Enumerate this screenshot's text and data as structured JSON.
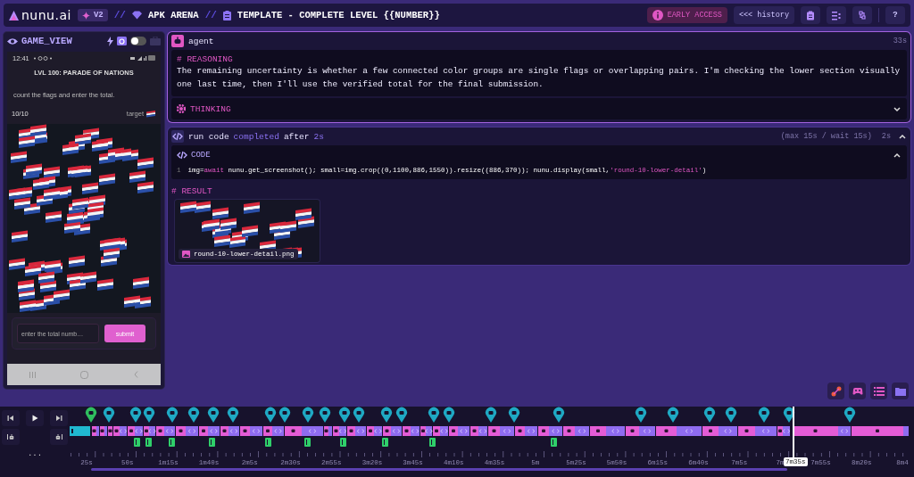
{
  "header": {
    "logo": "nunu.ai",
    "version": "V2",
    "breadcrumbs": [
      {
        "kind": "arena",
        "separator": "//",
        "label": "APK ARENA"
      },
      {
        "kind": "template",
        "separator": "//",
        "label": "TEMPLATE - COMPLETE LEVEL {{NUMBER}}"
      }
    ],
    "early_access": "EARLY ACCESS",
    "history_button": "<<< history",
    "help_button": "?"
  },
  "game_view": {
    "title": "GAME_VIEW",
    "stream_toggle": {
      "on": false
    },
    "phone": {
      "clock": "12:41",
      "level_title": "LVL 100: PARADE OF NATIONS",
      "instruction": "count the flags and enter the total.",
      "progress": "10/10",
      "target_label": "target",
      "input_placeholder": "enter the total numb…",
      "submit": "submit"
    }
  },
  "agent_card": {
    "name": "agent",
    "elapsed": "33s",
    "reasoning_heading": "# REASONING",
    "reasoning": "The remaining uncertainty is whether a few connected color groups are single flags or overlapping pairs. I'm checking the lower section visually one last time, then I'll use the verified total for the final submission.",
    "thinking_label": "THINKING",
    "thinking_expanded": false
  },
  "run_code_card": {
    "title": "run code",
    "status": "completed",
    "after": "after",
    "duration": "2s",
    "limits": "(max 15s / wait 15s)",
    "elapsed": "2s",
    "expanded": true,
    "code_heading": "CODE",
    "code_expanded": true,
    "code_lines": [
      {
        "number": "1",
        "tokens": [
          {
            "kind": "plain",
            "text": "img="
          },
          {
            "kind": "keyword",
            "text": "await"
          },
          {
            "kind": "plain",
            "text": " nunu.get_screenshot(); small=img.crop((0,1100,886,1550)).resize((886,370)); nunu.display(small,"
          },
          {
            "kind": "string",
            "text": "'round-10-lower-detail'"
          },
          {
            "kind": "plain",
            "text": ")"
          }
        ]
      }
    ],
    "result_heading": "# RESULT",
    "result_file": "round-10-lower-detail.png"
  },
  "timeline": {
    "tick_labels": [
      "25s",
      "50s",
      "1m15s",
      "1m40s",
      "2m5s",
      "2m30s",
      "2m55s",
      "3m20s",
      "3m45s",
      "4m10s",
      "4m35s",
      "5m",
      "5m25s",
      "5m50s",
      "6m15s",
      "6m40s",
      "7m5s",
      "7m",
      "7m55s",
      "8m20s",
      "8m4"
    ],
    "playhead": "7m35s",
    "more_button": "..."
  }
}
